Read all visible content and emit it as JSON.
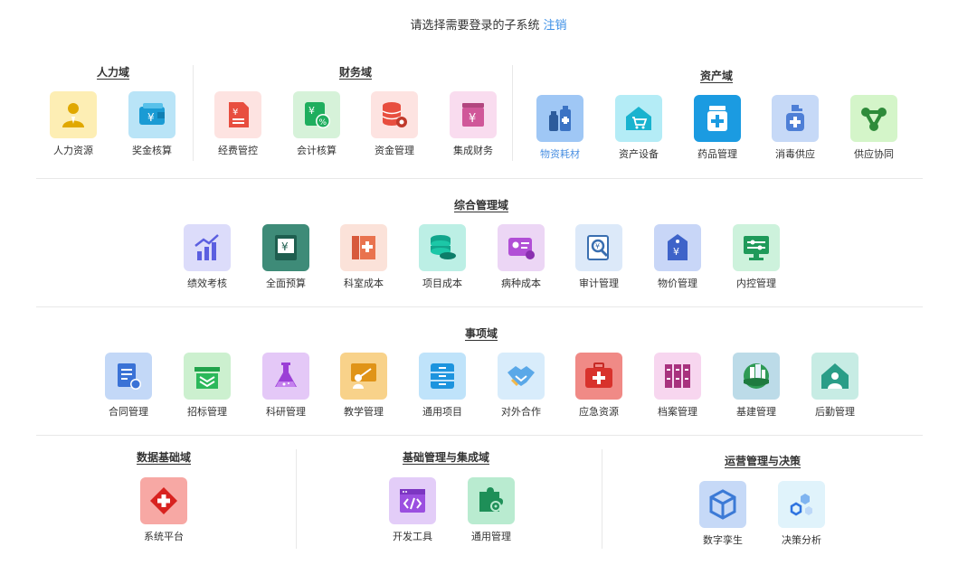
{
  "header": {
    "prompt": "请选择需要登录的子系统",
    "logout": "注销"
  },
  "row1": {
    "hr": {
      "title": "人力域",
      "items": [
        "人力资源",
        "奖金核算"
      ]
    },
    "finance": {
      "title": "财务域",
      "items": [
        "经费管控",
        "会计核算",
        "资金管理",
        "集成财务"
      ]
    },
    "asset": {
      "title": "资产域",
      "items": [
        "物资耗材",
        "资产设备",
        "药品管理",
        "消毒供应",
        "供应协同"
      ]
    }
  },
  "row2": {
    "title": "综合管理域",
    "items": [
      "绩效考核",
      "全面预算",
      "科室成本",
      "项目成本",
      "病种成本",
      "审计管理",
      "物价管理",
      "内控管理"
    ]
  },
  "row3": {
    "title": "事项域",
    "items": [
      "合同管理",
      "招标管理",
      "科研管理",
      "教学管理",
      "通用项目",
      "对外合作",
      "应急资源",
      "档案管理",
      "基建管理",
      "后勤管理"
    ]
  },
  "row4": {
    "data": {
      "title": "数据基础域",
      "items": [
        "系统平台"
      ]
    },
    "infra": {
      "title": "基础管理与集成域",
      "items": [
        "开发工具",
        "通用管理"
      ]
    },
    "ops": {
      "title": "运营管理与决策",
      "items": [
        "数字孪生",
        "决策分析"
      ]
    }
  }
}
